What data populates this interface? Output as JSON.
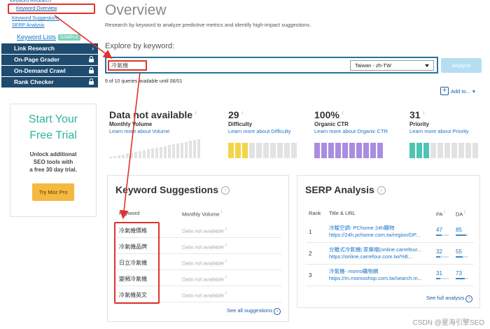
{
  "sidebar": {
    "sub_links": {
      "cut_top": "Keyword Research",
      "keyword_overview": "Keyword Overview",
      "keyword_suggestions": "Keyword Suggestions",
      "serp_analysis": "SERP Analysis"
    },
    "keyword_lists": {
      "label": "Keyword Lists",
      "badge": "SAMPLE"
    },
    "nav_items": [
      {
        "label": "Link Research",
        "icon": "chevron-right-icon"
      },
      {
        "label": "On-Page Grader",
        "icon": "lock-icon"
      },
      {
        "label": "On-Demand Crawl",
        "icon": "lock-icon"
      },
      {
        "label": "Rank Checker",
        "icon": "lock-icon"
      }
    ],
    "trial": {
      "title_line1": "Start Your",
      "title_line2": "Free Trial",
      "desc_line1": "Unlock additional",
      "desc_line2": "SEO tools with",
      "desc_line3": "a free 30 day trial.",
      "button": "Try Moz Pro"
    }
  },
  "header": {
    "title": "Overview",
    "subtitle": "Research by keyword to analyze predictive metrics and identify high-impact suggestions."
  },
  "search": {
    "label": "Explore by keyword:",
    "value": "冷氣機",
    "locale": "Taiwan - zh-TW",
    "analyze_label": "Analyze",
    "queries_text": "9 of 10 queries available until 06/01",
    "add_to_label": "Add to..."
  },
  "metrics": {
    "volume": {
      "value": "Data not available",
      "label": "Monthly Volume",
      "link": "Learn more about Volume"
    },
    "difficulty": {
      "value": "29",
      "label": "Difficulty",
      "link": "Learn more about Difficulty",
      "level": 0.29
    },
    "ctr": {
      "value": "100%",
      "label": "Organic CTR",
      "link": "Learn more about Organic CTR",
      "level": 1.0
    },
    "priority": {
      "value": "31",
      "label": "Priority",
      "link": "Learn more about Priority",
      "level": 0.31
    }
  },
  "colors": {
    "difficulty": "#f3d34a",
    "ctr": "#a98de0",
    "priority": "#4fc4b4",
    "empty": "#e2e2e2",
    "highlight": "#e0322b",
    "nav_bg": "#1e4b6e"
  },
  "keyword_suggestions": {
    "title": "Keyword Suggestions",
    "col_keyword": "Keyword",
    "col_volume": "Monthly Volume",
    "rows": [
      {
        "keyword": "冷氣機價格",
        "volume": "Data not available"
      },
      {
        "keyword": "冷氣機品牌",
        "volume": "Data not available"
      },
      {
        "keyword": "日立冷氣機",
        "volume": "Data not available"
      },
      {
        "keyword": "變頻冷氣機",
        "volume": "Data not available"
      },
      {
        "keyword": "冷氣機英文",
        "volume": "Data not available"
      }
    ],
    "see_all": "See all suggestions"
  },
  "serp": {
    "title": "SERP Analysis",
    "col_rank": "Rank",
    "col_title": "Title & URL",
    "col_pa": "PA",
    "col_da": "DA",
    "rows": [
      {
        "rank": "1",
        "title": "冷暖空調- PChome 24h購物",
        "url": "https://24h.pchome.com.tw/region/DP...",
        "pa": "47",
        "da": "85"
      },
      {
        "rank": "2",
        "title": "分離式冷氣機| 家樂福(online.carrefour...",
        "url": "https://online.carrefour.com.tw/%E...",
        "pa": "32",
        "da": "55"
      },
      {
        "rank": "3",
        "title": "冷氣機- momo購物網",
        "url": "https://m.momoshop.com.tw/search.m...",
        "pa": "31",
        "da": "73"
      }
    ],
    "see_full": "See full analysis"
  },
  "watermark": "CSDN @星海引擎SEO"
}
